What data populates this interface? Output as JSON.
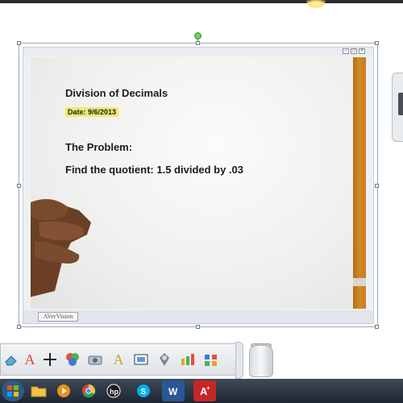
{
  "document": {
    "title": "Division of Decimals",
    "date": "Date: 9/6/2013",
    "problem_label": "The Problem:",
    "problem_text": "Find the quotient:  1.5 divided by .03"
  },
  "viewer": {
    "footer_label": "AVerVision"
  },
  "palette": {
    "tools": [
      "eraser-tool",
      "text-tool",
      "crosshair-tool",
      "shapes-tool",
      "camera-tool",
      "text-art-tool",
      "screen-capture-tool",
      "spotlight-tool",
      "chart-tool",
      "gallery-tool"
    ]
  },
  "taskbar": {
    "apps": [
      "folder",
      "media-player",
      "chrome",
      "hp",
      "skype",
      "word",
      "acrobat"
    ]
  },
  "colors": {
    "date_highlight": "#f0ea6e",
    "rotation_handle": "#6fd15a",
    "taskbar": "#1d2631"
  }
}
